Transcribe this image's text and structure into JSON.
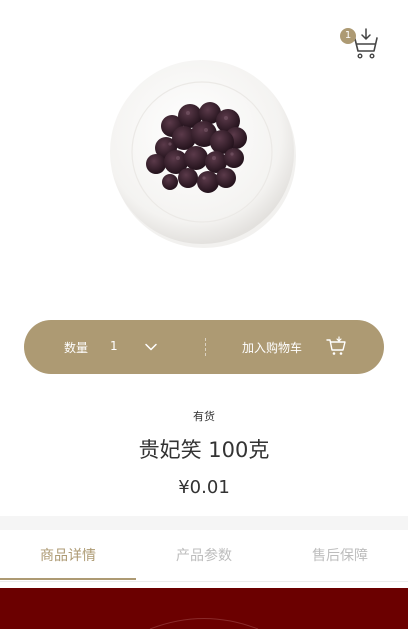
{
  "header": {
    "cart_count": "1",
    "cart_icon": "shopping-cart-download-icon"
  },
  "product": {
    "image": "bowl-of-dried-berries",
    "stock": "有货",
    "title": "贵妃笑 100克",
    "price": "¥0.01"
  },
  "action_bar": {
    "qty_label": "数量",
    "qty_value": "1",
    "qty_icon": "chevron-down-icon",
    "add_to_cart_label": "加入购物车",
    "add_to_cart_icon": "cart-icon"
  },
  "tabs": [
    {
      "label": "商品详情",
      "active": true
    },
    {
      "label": "产品参数",
      "active": false
    },
    {
      "label": "售后保障",
      "active": false
    }
  ],
  "colors": {
    "accent": "#ad9a73",
    "banner": "#6b0000",
    "text": "#333333",
    "muted": "#bdbdbd"
  }
}
